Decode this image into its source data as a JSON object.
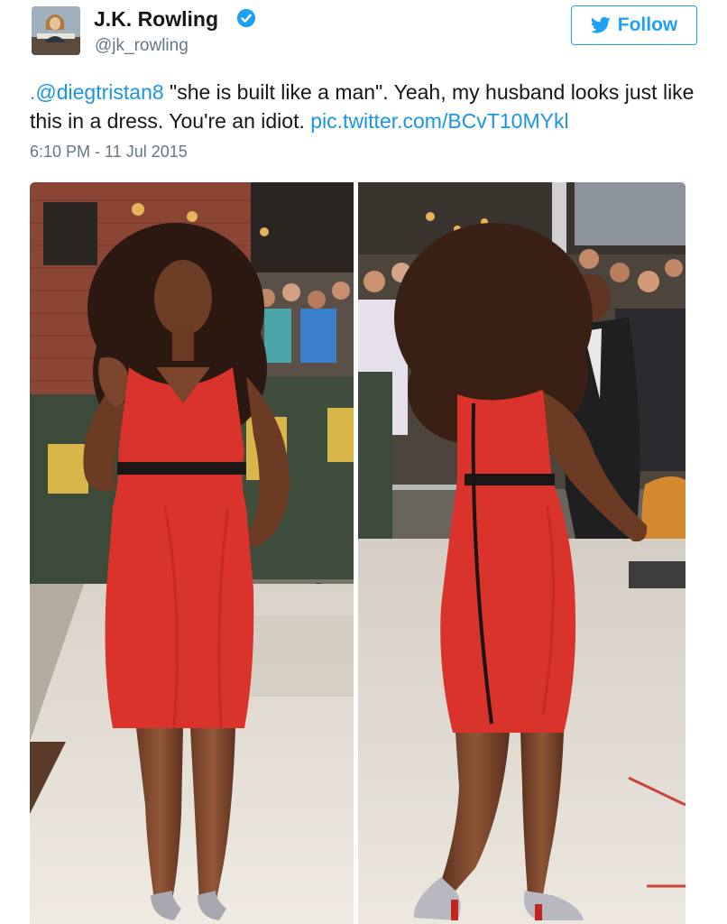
{
  "author": {
    "display_name": "J.K. Rowling",
    "handle": "@jk_rowling",
    "verified": true,
    "avatar_icon": "profile-photo"
  },
  "follow_button": {
    "label": "Follow",
    "icon": "twitter-bird-icon",
    "accent_color": "#1da1f2"
  },
  "tweet": {
    "mention": ".@diegtristan8",
    "body": " \"she is built like a man\". Yeah, my husband looks just like this in a dress. You're an idiot. ",
    "link": "pic.twitter.com/BCvT10MYkl",
    "timestamp": "6:10 PM - 11 Jul 2015",
    "link_color": "#1b95e0"
  },
  "media": {
    "photo_count": 2,
    "photos": [
      "photo-front-view",
      "photo-back-view"
    ]
  }
}
